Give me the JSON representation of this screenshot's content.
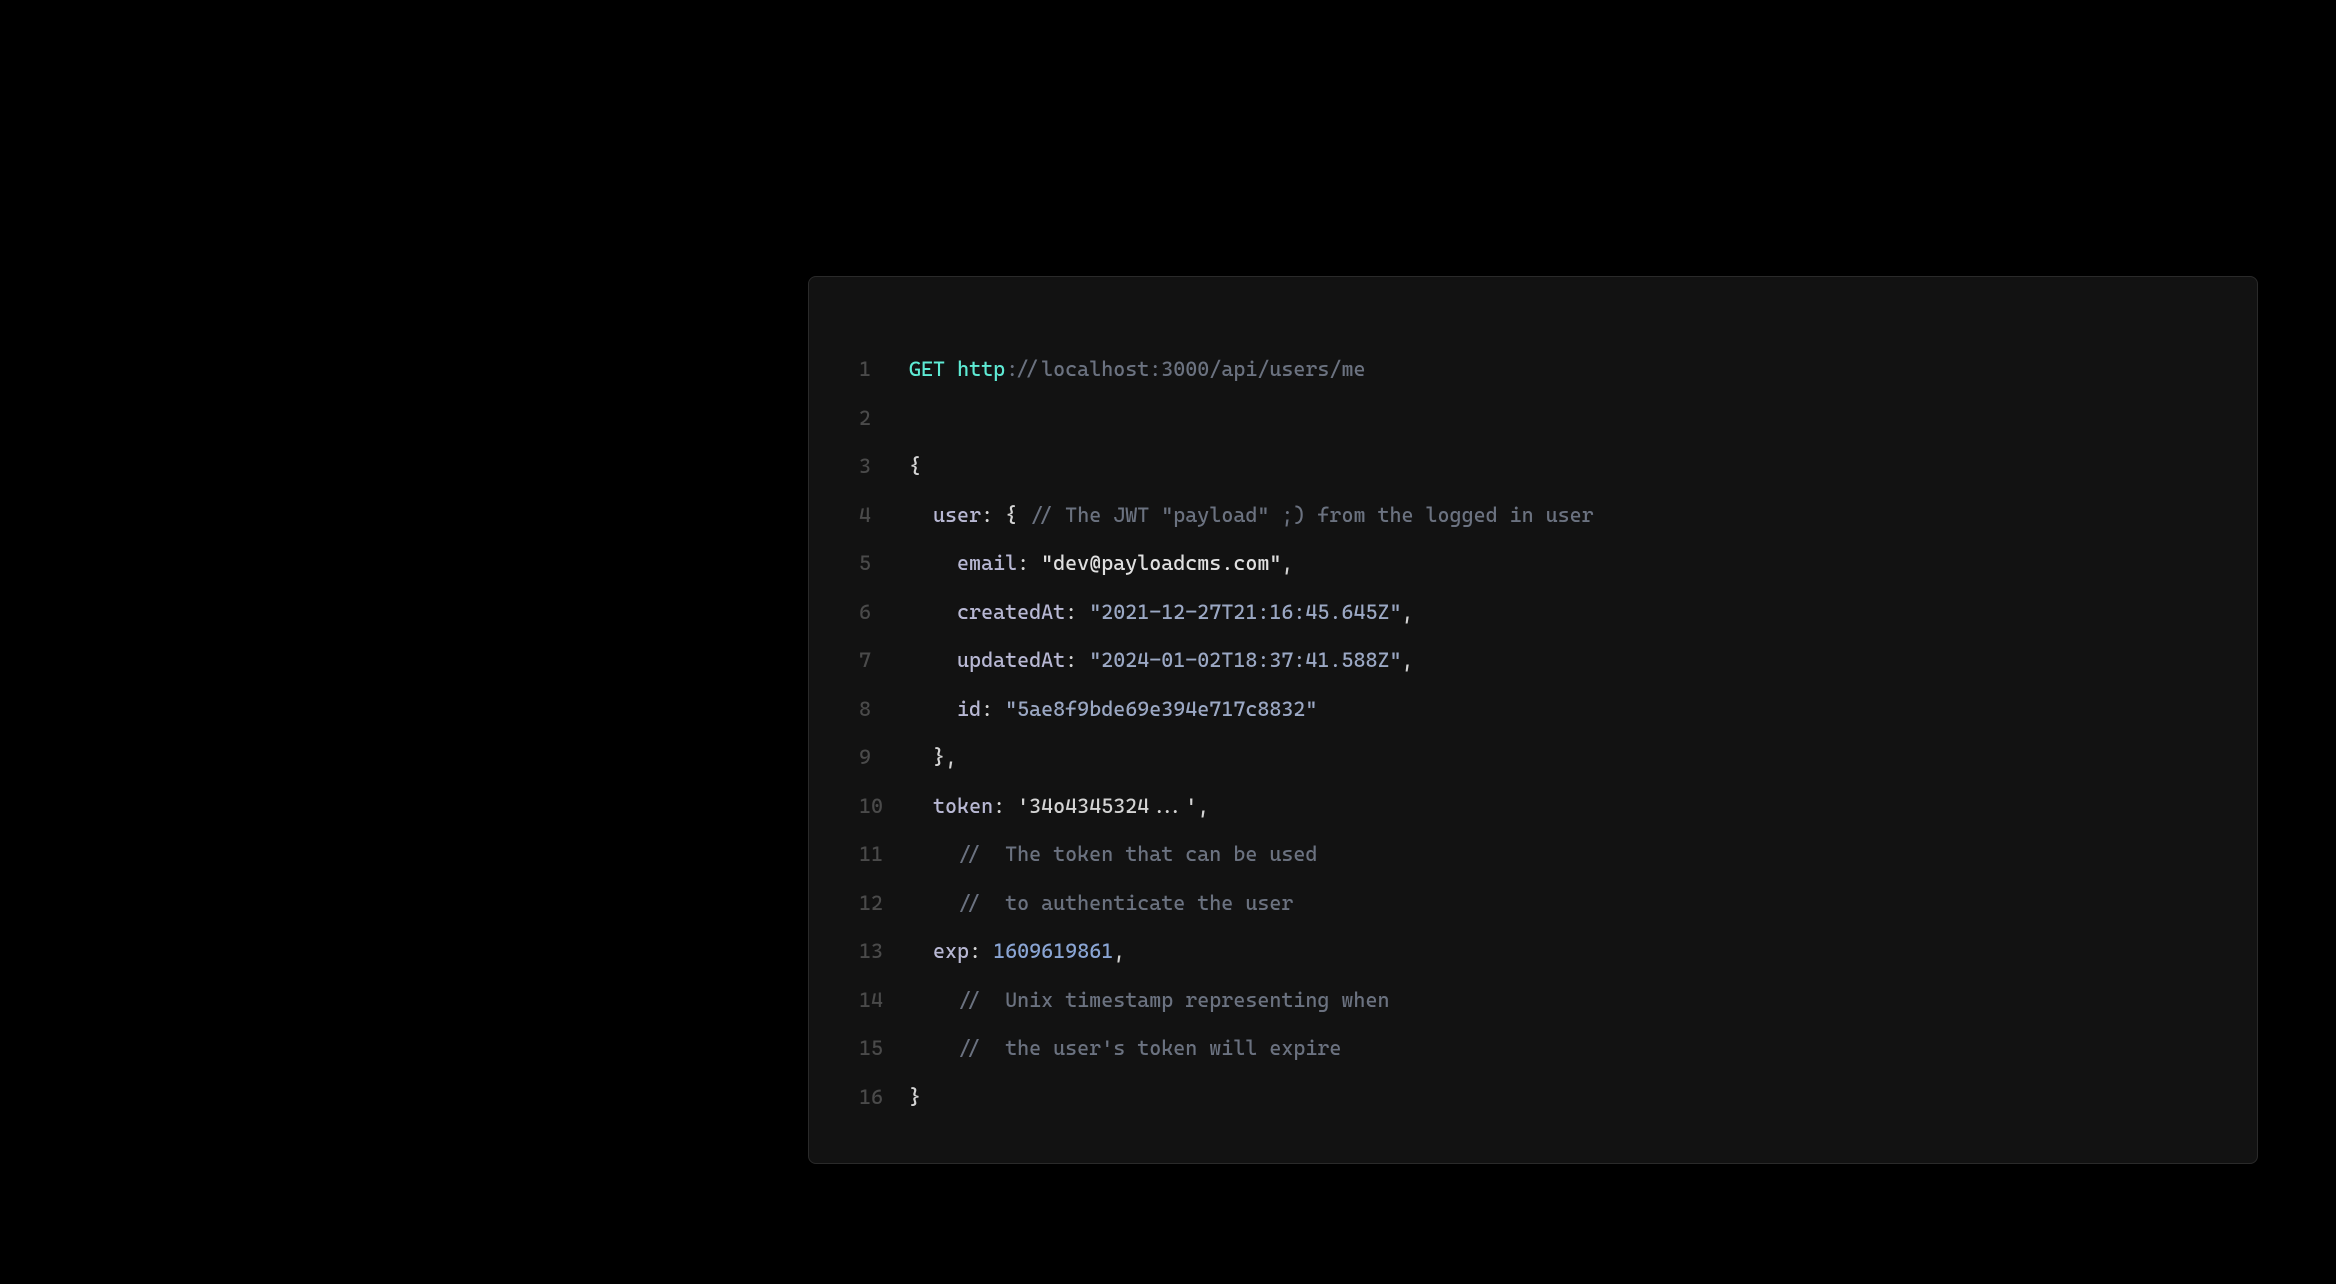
{
  "code": {
    "method": "GET",
    "protocol": "http",
    "url_rest": "://localhost:3000/api/users/me",
    "brace_open": "{",
    "user_key": "user",
    "user_open_brace": "{",
    "user_comment": "// The JWT \"payload\" ;) from the logged in user",
    "email_key": "email",
    "email_value": "\"dev@payloadcms.com\"",
    "createdAt_key": "createdAt",
    "createdAt_value": "\"2021-12-27T21:16:45.645Z\"",
    "updatedAt_key": "updatedAt",
    "updatedAt_value": "\"2024-01-02T18:37:41.588Z\"",
    "id_key": "id",
    "id_value": "\"5ae8f9bde69e394e717c8832\"",
    "user_close": "},",
    "token_key": "token",
    "token_value": "'34o4345324...'",
    "token_comment1": "//  The token that can be used",
    "token_comment2": "//  to authenticate the user",
    "exp_key": "exp",
    "exp_value": "1609619861",
    "exp_comment1": "//  Unix timestamp representing when",
    "exp_comment2": "//  the user's token will expire",
    "brace_close": "}",
    "line_numbers": [
      "1",
      "2",
      "3",
      "4",
      "5",
      "6",
      "7",
      "8",
      "9",
      "10",
      "11",
      "12",
      "13",
      "14",
      "15",
      "16"
    ]
  }
}
